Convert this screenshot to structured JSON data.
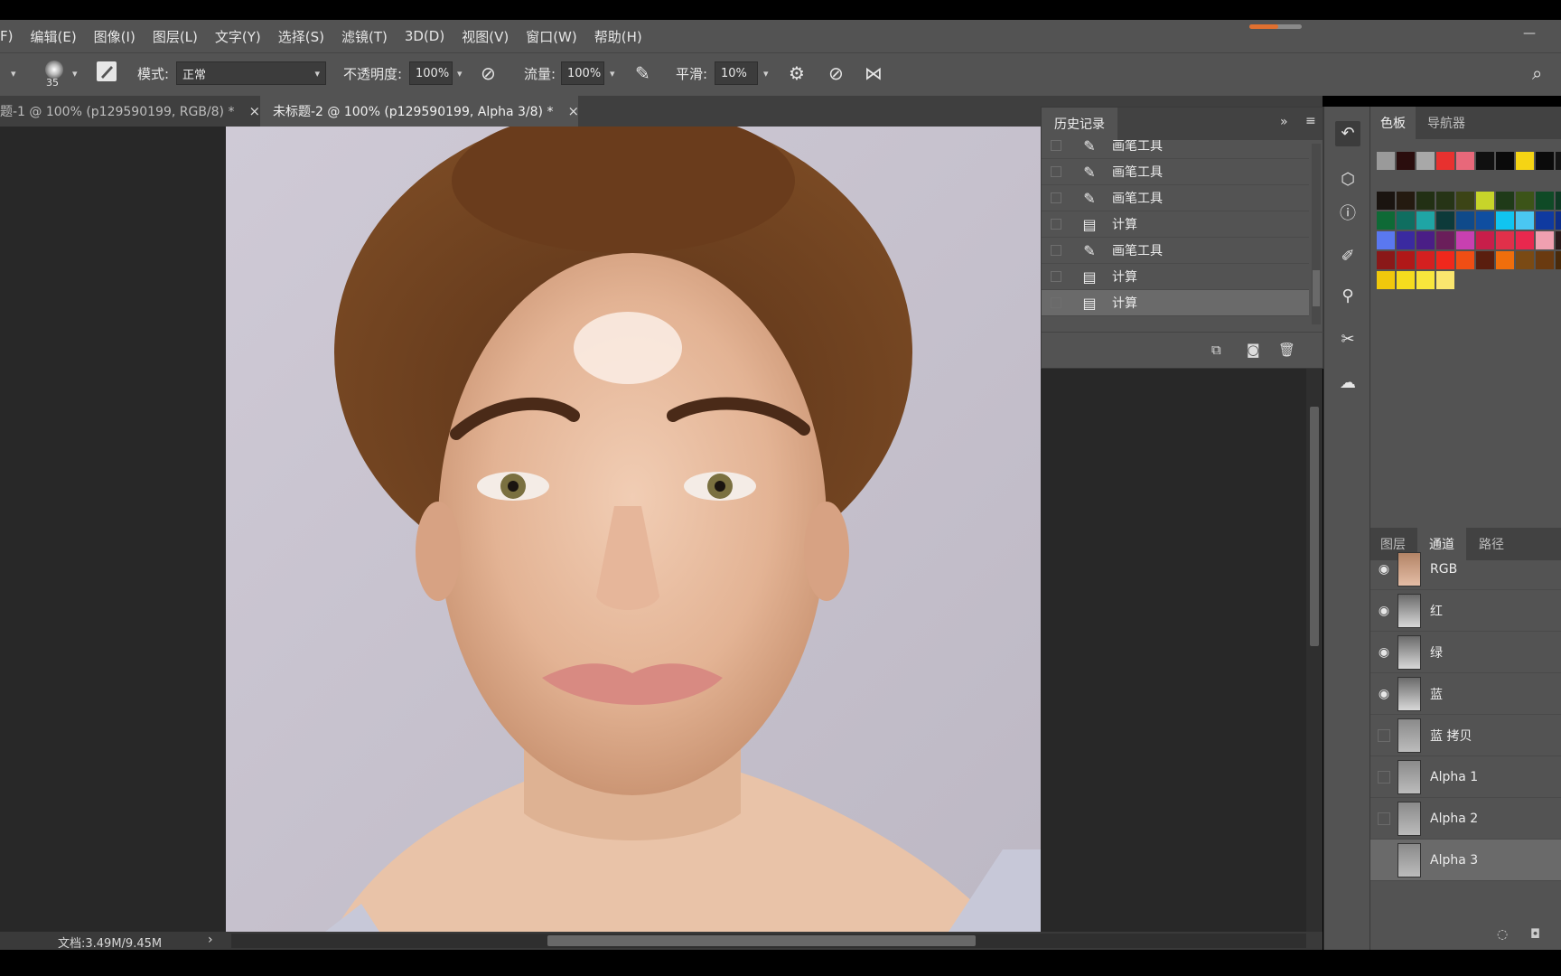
{
  "menu": {
    "items": [
      "F)",
      "编辑(E)",
      "图像(I)",
      "图层(L)",
      "文字(Y)",
      "选择(S)",
      "滤镜(T)",
      "3D(D)",
      "视图(V)",
      "窗口(W)",
      "帮助(H)"
    ],
    "window_minimize": "—"
  },
  "options": {
    "brush_size": "35",
    "mode_label": "模式:",
    "mode_value": "正常",
    "opacity_label": "不透明度:",
    "opacity_value": "100%",
    "flow_label": "流量:",
    "flow_value": "100%",
    "smooth_label": "平滑:",
    "smooth_value": "10%"
  },
  "tabs": [
    {
      "label": "题-1 @ 100% (p129590199, RGB/8) *",
      "active": false
    },
    {
      "label": "未标题-2 @ 100% (p129590199, Alpha 3/8) *",
      "active": true
    }
  ],
  "tab_close": "×",
  "status": {
    "doc": "文档:3.49M/9.45M",
    "arrow": "›"
  },
  "history": {
    "title": "历史记录",
    "collapse": "»",
    "items": [
      {
        "label": "画笔工具",
        "icon": "brush-icon"
      },
      {
        "label": "画笔工具",
        "icon": "brush-icon"
      },
      {
        "label": "画笔工具",
        "icon": "brush-icon"
      },
      {
        "label": "计算",
        "icon": "document-icon"
      },
      {
        "label": "画笔工具",
        "icon": "brush-icon"
      },
      {
        "label": "计算",
        "icon": "document-icon"
      },
      {
        "label": "计算",
        "icon": "document-icon",
        "selected": true
      }
    ]
  },
  "swatch_panel": {
    "tabs": [
      "色板",
      "导航器"
    ],
    "colors": [
      [
        "#9a9a9a",
        "#2a0d0d",
        "#a8a8a8",
        "#e8312f",
        "#e8687a",
        "#101010",
        "#0a0a0a",
        "#f5d414",
        "#0b0b0b",
        "#151515"
      ],
      [
        "#1a1410",
        "#241a10",
        "#223014",
        "#263416",
        "#3c4416",
        "#c7d42a",
        "#1f3a18",
        "#3c5418",
        "#0f4a26",
        "#0f3a24"
      ],
      [
        "#0e6a36",
        "#0f6e60",
        "#1fa5a5",
        "#0d3a3a",
        "#0f4a8a",
        "#0f4ea0",
        "#11c4f0",
        "#4ac7f2",
        "#0f3aa0",
        "#0e2e88"
      ],
      [
        "#5a78f0",
        "#3a2aa0",
        "#4a1e86",
        "#6a1e5a",
        "#c840b0",
        "#c81e4a",
        "#e0304a",
        "#e8284e",
        "#f0a0b0",
        "#2a1a1a"
      ],
      [
        "#8a1818",
        "#b01818",
        "#d42020",
        "#f0281c",
        "#f04e14",
        "#5a1e0e",
        "#f06e0c",
        "#7a4a14",
        "#6a3a10",
        "#4a2a0a"
      ],
      [
        "#f0c80c",
        "#f5dc1e",
        "#f8e63c",
        "#fae66e"
      ]
    ]
  },
  "channels_panel": {
    "tabs": [
      "图层",
      "通道",
      "路径"
    ],
    "items": [
      {
        "label": "RGB",
        "visible": true
      },
      {
        "label": "红",
        "visible": true
      },
      {
        "label": "绿",
        "visible": true
      },
      {
        "label": "蓝",
        "visible": true
      },
      {
        "label": "蓝 拷贝",
        "visible": false
      },
      {
        "label": "Alpha 1",
        "visible": false
      },
      {
        "label": "Alpha 2",
        "visible": false
      },
      {
        "label": "Alpha 3",
        "visible": false,
        "selected": true
      }
    ]
  },
  "accent": {
    "progress": "#e07030",
    "progress_fraction": 0.55
  }
}
